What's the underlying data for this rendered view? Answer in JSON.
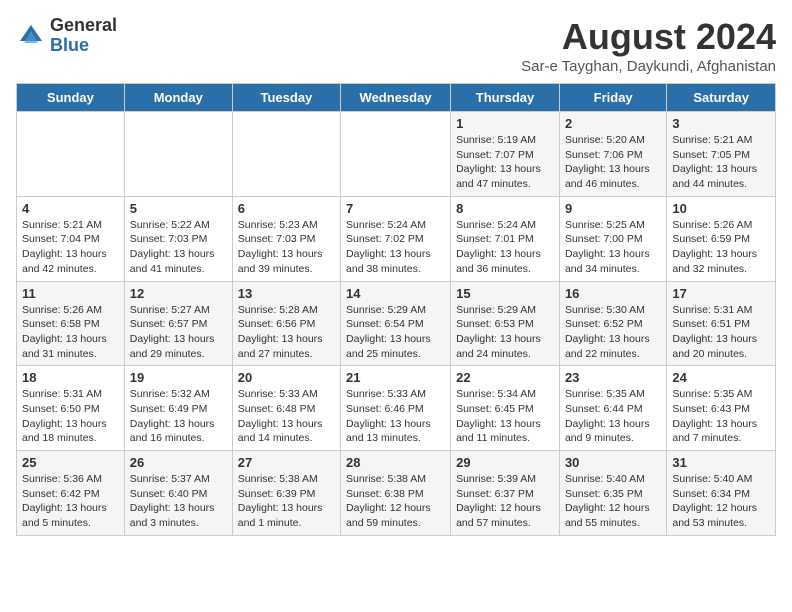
{
  "logo": {
    "general": "General",
    "blue": "Blue"
  },
  "title": "August 2024",
  "subtitle": "Sar-e Tayghan, Daykundi, Afghanistan",
  "headers": [
    "Sunday",
    "Monday",
    "Tuesday",
    "Wednesday",
    "Thursday",
    "Friday",
    "Saturday"
  ],
  "weeks": [
    [
      {
        "day": "",
        "info": ""
      },
      {
        "day": "",
        "info": ""
      },
      {
        "day": "",
        "info": ""
      },
      {
        "day": "",
        "info": ""
      },
      {
        "day": "1",
        "info": "Sunrise: 5:19 AM\nSunset: 7:07 PM\nDaylight: 13 hours\nand 47 minutes."
      },
      {
        "day": "2",
        "info": "Sunrise: 5:20 AM\nSunset: 7:06 PM\nDaylight: 13 hours\nand 46 minutes."
      },
      {
        "day": "3",
        "info": "Sunrise: 5:21 AM\nSunset: 7:05 PM\nDaylight: 13 hours\nand 44 minutes."
      }
    ],
    [
      {
        "day": "4",
        "info": "Sunrise: 5:21 AM\nSunset: 7:04 PM\nDaylight: 13 hours\nand 42 minutes."
      },
      {
        "day": "5",
        "info": "Sunrise: 5:22 AM\nSunset: 7:03 PM\nDaylight: 13 hours\nand 41 minutes."
      },
      {
        "day": "6",
        "info": "Sunrise: 5:23 AM\nSunset: 7:03 PM\nDaylight: 13 hours\nand 39 minutes."
      },
      {
        "day": "7",
        "info": "Sunrise: 5:24 AM\nSunset: 7:02 PM\nDaylight: 13 hours\nand 38 minutes."
      },
      {
        "day": "8",
        "info": "Sunrise: 5:24 AM\nSunset: 7:01 PM\nDaylight: 13 hours\nand 36 minutes."
      },
      {
        "day": "9",
        "info": "Sunrise: 5:25 AM\nSunset: 7:00 PM\nDaylight: 13 hours\nand 34 minutes."
      },
      {
        "day": "10",
        "info": "Sunrise: 5:26 AM\nSunset: 6:59 PM\nDaylight: 13 hours\nand 32 minutes."
      }
    ],
    [
      {
        "day": "11",
        "info": "Sunrise: 5:26 AM\nSunset: 6:58 PM\nDaylight: 13 hours\nand 31 minutes."
      },
      {
        "day": "12",
        "info": "Sunrise: 5:27 AM\nSunset: 6:57 PM\nDaylight: 13 hours\nand 29 minutes."
      },
      {
        "day": "13",
        "info": "Sunrise: 5:28 AM\nSunset: 6:56 PM\nDaylight: 13 hours\nand 27 minutes."
      },
      {
        "day": "14",
        "info": "Sunrise: 5:29 AM\nSunset: 6:54 PM\nDaylight: 13 hours\nand 25 minutes."
      },
      {
        "day": "15",
        "info": "Sunrise: 5:29 AM\nSunset: 6:53 PM\nDaylight: 13 hours\nand 24 minutes."
      },
      {
        "day": "16",
        "info": "Sunrise: 5:30 AM\nSunset: 6:52 PM\nDaylight: 13 hours\nand 22 minutes."
      },
      {
        "day": "17",
        "info": "Sunrise: 5:31 AM\nSunset: 6:51 PM\nDaylight: 13 hours\nand 20 minutes."
      }
    ],
    [
      {
        "day": "18",
        "info": "Sunrise: 5:31 AM\nSunset: 6:50 PM\nDaylight: 13 hours\nand 18 minutes."
      },
      {
        "day": "19",
        "info": "Sunrise: 5:32 AM\nSunset: 6:49 PM\nDaylight: 13 hours\nand 16 minutes."
      },
      {
        "day": "20",
        "info": "Sunrise: 5:33 AM\nSunset: 6:48 PM\nDaylight: 13 hours\nand 14 minutes."
      },
      {
        "day": "21",
        "info": "Sunrise: 5:33 AM\nSunset: 6:46 PM\nDaylight: 13 hours\nand 13 minutes."
      },
      {
        "day": "22",
        "info": "Sunrise: 5:34 AM\nSunset: 6:45 PM\nDaylight: 13 hours\nand 11 minutes."
      },
      {
        "day": "23",
        "info": "Sunrise: 5:35 AM\nSunset: 6:44 PM\nDaylight: 13 hours\nand 9 minutes."
      },
      {
        "day": "24",
        "info": "Sunrise: 5:35 AM\nSunset: 6:43 PM\nDaylight: 13 hours\nand 7 minutes."
      }
    ],
    [
      {
        "day": "25",
        "info": "Sunrise: 5:36 AM\nSunset: 6:42 PM\nDaylight: 13 hours\nand 5 minutes."
      },
      {
        "day": "26",
        "info": "Sunrise: 5:37 AM\nSunset: 6:40 PM\nDaylight: 13 hours\nand 3 minutes."
      },
      {
        "day": "27",
        "info": "Sunrise: 5:38 AM\nSunset: 6:39 PM\nDaylight: 13 hours\nand 1 minute."
      },
      {
        "day": "28",
        "info": "Sunrise: 5:38 AM\nSunset: 6:38 PM\nDaylight: 12 hours\nand 59 minutes."
      },
      {
        "day": "29",
        "info": "Sunrise: 5:39 AM\nSunset: 6:37 PM\nDaylight: 12 hours\nand 57 minutes."
      },
      {
        "day": "30",
        "info": "Sunrise: 5:40 AM\nSunset: 6:35 PM\nDaylight: 12 hours\nand 55 minutes."
      },
      {
        "day": "31",
        "info": "Sunrise: 5:40 AM\nSunset: 6:34 PM\nDaylight: 12 hours\nand 53 minutes."
      }
    ]
  ]
}
